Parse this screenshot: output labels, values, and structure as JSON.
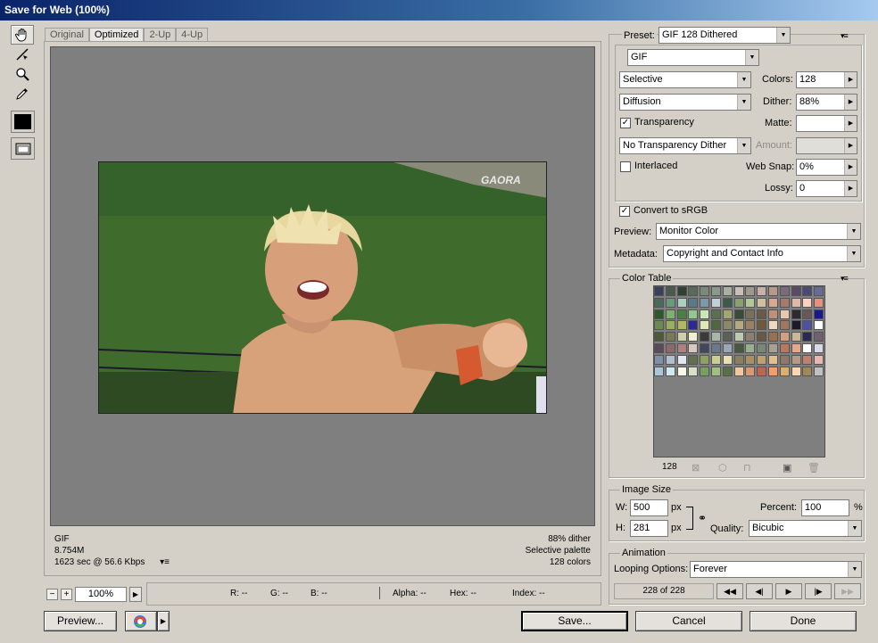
{
  "window": {
    "title": "Save for Web (100%)"
  },
  "tabs": [
    "Original",
    "Optimized",
    "2-Up",
    "4-Up"
  ],
  "photo": {
    "watermark": "GAORA"
  },
  "info": {
    "left": [
      "GIF",
      "8.754M",
      "1623 sec @ 56.6 Kbps"
    ],
    "right": [
      "88% dither",
      "Selective palette",
      "128 colors"
    ]
  },
  "zoom": {
    "minus": "−",
    "plus": "+",
    "value": "100%"
  },
  "pixel_info": {
    "r": "R: --",
    "g": "G: --",
    "b": "B: --",
    "alpha": "Alpha: --",
    "hex": "Hex: --",
    "index": "Index: --"
  },
  "buttons": {
    "preview": "Preview...",
    "save": "Save...",
    "cancel": "Cancel",
    "done": "Done"
  },
  "settings": {
    "preset_label": "Preset:",
    "preset_value": "GIF 128 Dithered",
    "format": "GIF",
    "reduction": "Selective",
    "colors_label": "Colors:",
    "colors_value": "128",
    "dither_algo": "Diffusion",
    "dither_label": "Dither:",
    "dither_value": "88%",
    "transparency_label": "Transparency",
    "transparency_checked": true,
    "matte_label": "Matte:",
    "matte_value": "",
    "trans_dither": "No Transparency Dither",
    "amount_label": "Amount:",
    "amount_value": "",
    "interlaced_label": "Interlaced",
    "interlaced_checked": false,
    "websnap_label": "Web Snap:",
    "websnap_value": "0%",
    "lossy_label": "Lossy:",
    "lossy_value": "0",
    "srgb_label": "Convert to sRGB",
    "srgb_checked": true,
    "preview_label": "Preview:",
    "preview_value": "Monitor Color",
    "metadata_label": "Metadata:",
    "metadata_value": "Copyright and Contact Info"
  },
  "color_table": {
    "title": "Color Table",
    "count": "128",
    "colors": [
      "#3a3f5c",
      "#4a5a4a",
      "#2f3f30",
      "#5a6a5a",
      "#7a8a7a",
      "#8a9a8a",
      "#aab0a0",
      "#c8c0b8",
      "#a09890",
      "#c8b0a8",
      "#b89a8a",
      "#7a6a7a",
      "#5a4a6a",
      "#4a4a7a",
      "#6a6a9a",
      "#4a6a5a",
      "#6a9a7a",
      "#aad0c0",
      "#5a7a8a",
      "#7a9aaa",
      "#c0d0d8",
      "#3a5a4a",
      "#8aa070",
      "#b0c898",
      "#d0c0a0",
      "#d8a890",
      "#a87a6a",
      "#e0b8a8",
      "#ffd0c0",
      "#e89080",
      "#2a5a2a",
      "#80b070",
      "#4a8040",
      "#90c890",
      "#c8e8b8",
      "#5a7050",
      "#a0a870",
      "#3a4a3a",
      "#78705a",
      "#6a5a4a",
      "#c09078",
      "#e8c8b0",
      "#302830",
      "#6a5858",
      "#1a1a80",
      "#6a8a50",
      "#9ab060",
      "#b0b860",
      "#2a2a90",
      "#e0e8b8",
      "#506840",
      "#8a8a6a",
      "#b8a880",
      "#988060",
      "#70583a",
      "#f0d8c0",
      "#a07860",
      "#1a1a2a",
      "#5050a0",
      "#ffffff",
      "#4a5a3a",
      "#7a7a5a",
      "#d0d0a8",
      "#f0f0d0",
      "#3a3a3a",
      "#a8b8a8",
      "#586058",
      "#c0c8b0",
      "#8a8070",
      "#685848",
      "#9a7050",
      "#d0a080",
      "#c8b898",
      "#2a2a4a",
      "#706070",
      "#5a4a5a",
      "#8a6a6a",
      "#b08080",
      "#d8c8c0",
      "#404860",
      "#6a7890",
      "#98a8b8",
      "#485840",
      "#98b090",
      "#788878",
      "#a8a090",
      "#b87860",
      "#e8a888",
      "#ffffff",
      "#d8d8e8",
      "#8090a8",
      "#b0c0d0",
      "#e0e8f0",
      "#607050",
      "#90a060",
      "#c8d090",
      "#e8e0b0",
      "#888060",
      "#a89060",
      "#c0a070",
      "#e0c090",
      "#907868",
      "#b89888",
      "#c08070",
      "#e8b8b0",
      "#a8c8d8",
      "#d0e8f0",
      "#f8f8e8",
      "#d8e0c8",
      "#78a060",
      "#a0c080",
      "#587048",
      "#f0c8a0",
      "#d89870",
      "#b86850",
      "#f0a070",
      "#d8b070",
      "#f8d8b0",
      "#a08858",
      "#c0c0c0"
    ]
  },
  "image_size": {
    "title": "Image Size",
    "w_label": "W:",
    "w_value": "500",
    "h_label": "H:",
    "h_value": "281",
    "unit": "px",
    "percent_label": "Percent:",
    "percent_value": "100",
    "percent_unit": "%",
    "quality_label": "Quality:",
    "quality_value": "Bicubic"
  },
  "animation": {
    "title": "Animation",
    "looping_label": "Looping Options:",
    "looping_value": "Forever",
    "frame_counter": "228 of 228",
    "controls": [
      "◀◀",
      "◀|",
      "▶",
      "|▶",
      "▶▶"
    ]
  }
}
